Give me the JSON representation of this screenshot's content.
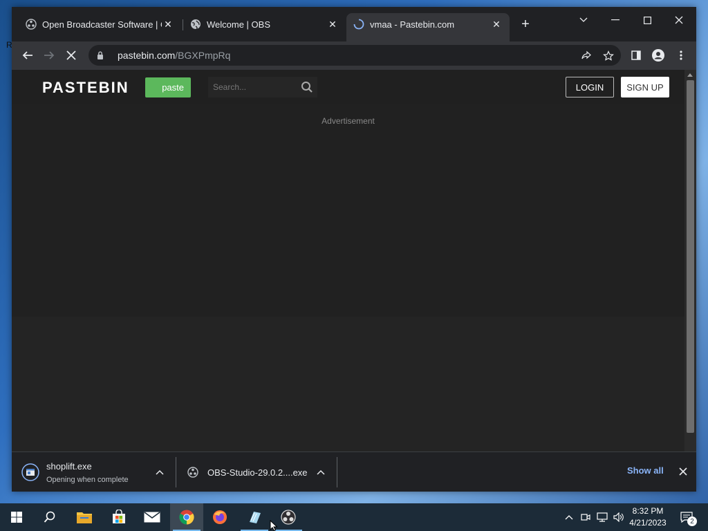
{
  "desktop": {
    "edge_fragment": "R"
  },
  "browser": {
    "tabs": [
      {
        "title": "Open Broadcaster Software | OBS",
        "icon": "obs-logo-icon"
      },
      {
        "title": "Welcome | OBS",
        "icon": "globe-icon"
      },
      {
        "title": "vmaa - Pastebin.com",
        "icon": "loading-spinner-icon"
      }
    ],
    "active_tab": 2,
    "new_tab_label": "+",
    "address": {
      "host": "pastebin.com",
      "path": "/BGXPmpRq"
    }
  },
  "page": {
    "logo": "PASTEBIN",
    "paste_button": "paste",
    "search_placeholder": "Search...",
    "login": "LOGIN",
    "signup": "SIGN UP",
    "ad_label": "Advertisement"
  },
  "downloads": {
    "items": [
      {
        "name": "shoplift.exe",
        "status": "Opening when complete"
      },
      {
        "name": "OBS-Studio-29.0.2....exe",
        "status": ""
      }
    ],
    "show_all": "Show all"
  },
  "taskbar": {
    "apps": [
      "start-icon",
      "search-icon",
      "file-explorer-icon",
      "store-icon",
      "mail-icon",
      "chrome-icon",
      "firefox-icon",
      "notepad-icon",
      "obs-icon"
    ],
    "time": "8:32 PM",
    "date": "4/21/2023",
    "notifications_count": "2"
  },
  "colors": {
    "accent_green": "#5cb85c",
    "link_blue": "#8ab4f8",
    "taskbar": "#1c2b38"
  }
}
